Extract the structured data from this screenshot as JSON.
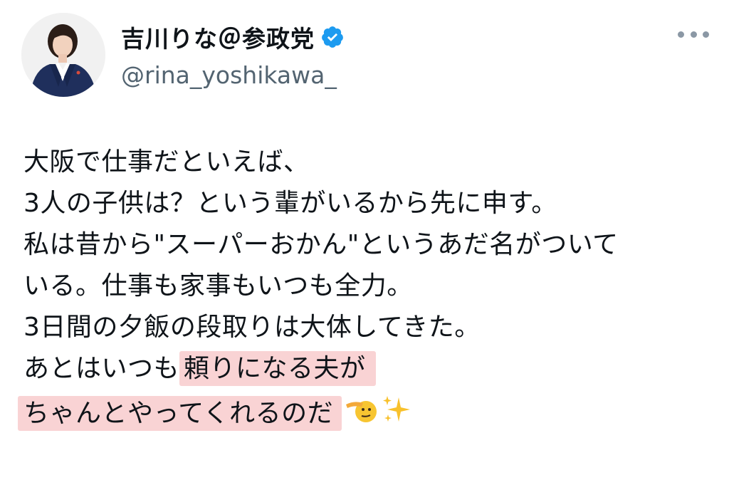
{
  "author": {
    "display_name": "吉川りな＠参政党",
    "handle": "@rina_yoshikawa_",
    "verified": true,
    "avatar_icon": "profile-photo"
  },
  "tweet": {
    "lines": [
      "大阪で仕事だといえば、",
      "3人の子供は？という輩がいるから先に申す。",
      "私は昔から\"スーパーおかん\"というあだ名がついて",
      "いる。仕事も家事もいつも全力。",
      "3日間の夕飯の段取りは大体してきた。"
    ],
    "line6_plain": "あとはいつも",
    "line6_highlight": "頼りになる夫が",
    "line7_highlight": "ちゃんとやってくれるのだ",
    "emojis": [
      "saluting-face",
      "sparkles"
    ]
  },
  "colors": {
    "verified_badge": "#1d9bf0",
    "highlight": "#f9d3d4",
    "handle_text": "#536471"
  }
}
